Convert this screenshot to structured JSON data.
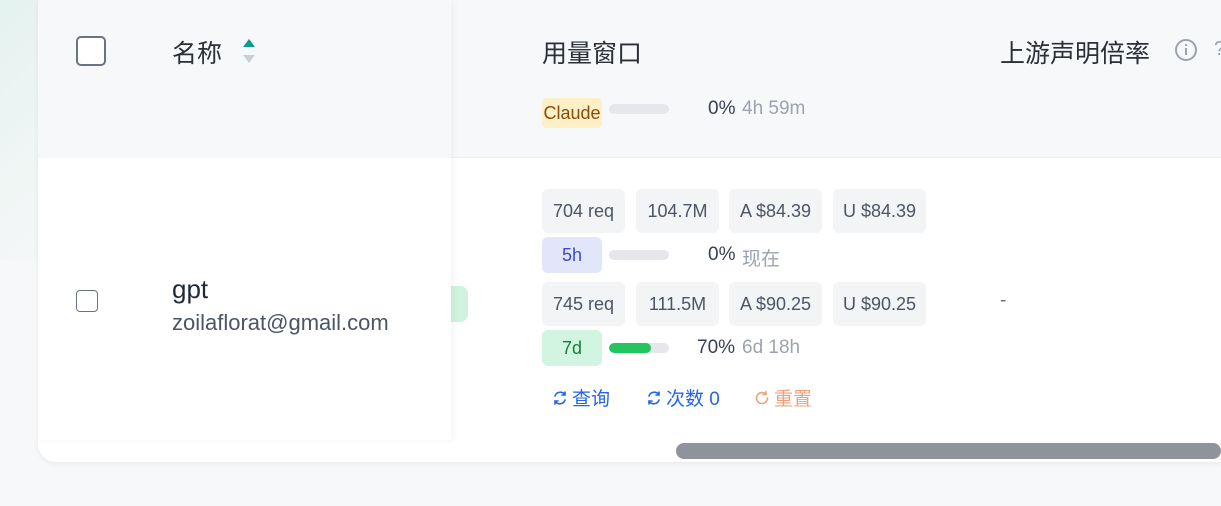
{
  "header": {
    "name_col": "名称",
    "usage_col": "用量窗口",
    "upstream_col": "上游声明倍率",
    "edge_glyph": "?"
  },
  "header_usage": {
    "claude_label": "Claude",
    "claude_progress": 0,
    "claude_pct": "0%",
    "claude_time": "4h 59m"
  },
  "row": {
    "name": "gpt",
    "email": "zoilaflorat@gmail.com",
    "upstream_value": "-",
    "window_5h": {
      "req": "704 req",
      "tokens": "104.7M",
      "a_cost": "A $84.39",
      "u_cost": "U $84.39",
      "label": "5h",
      "progress": 0,
      "pct": "0%",
      "time": "现在"
    },
    "window_7d": {
      "req": "745 req",
      "tokens": "111.5M",
      "a_cost": "A $90.25",
      "u_cost": "U $90.25",
      "label": "7d",
      "progress": 70,
      "pct": "70%",
      "time": "6d 18h"
    },
    "actions": {
      "query": "查询",
      "count": "次数 0",
      "reset": "重置"
    }
  },
  "colors": {
    "accent_blue": "#2563eb",
    "progress_green": "#22c55e",
    "reset_orange": "#f0a07a",
    "sort_active": "#0f9b8e"
  }
}
